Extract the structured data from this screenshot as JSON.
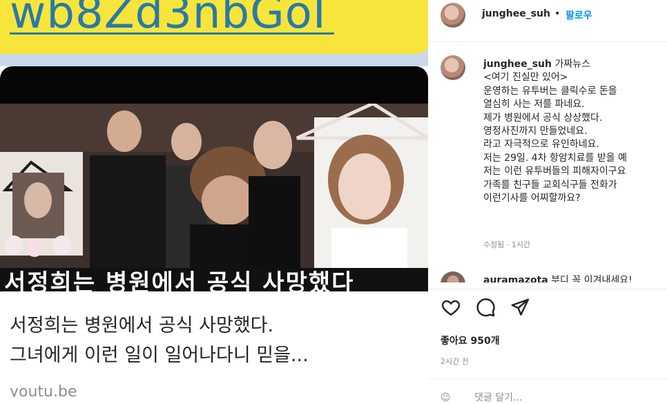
{
  "promo": {
    "url_text": "wb8Zd3nbGoI"
  },
  "video_card": {
    "caption_overlay": "서정희는 병원에서 공식 사망했다",
    "title_line1": "서정희는 병원에서 공식 사망했다.",
    "title_line2": "그녀에게 이런 일이 일어나다니 믿을...",
    "domain": "youtu.be"
  },
  "header": {
    "username": "junghee_suh",
    "separator": "•",
    "follow_label": "팔로우"
  },
  "post": {
    "username": "junghee_suh",
    "lines": [
      "가짜뉴스",
      "<여기 진실만 있어>",
      "운영하는 유투버는 클릭수로 돈을",
      "열심히 사는 저를 파네요.",
      "제가 병원에서 공식 상상했다.",
      "영정사진까지 만들었네요.",
      "라고 자극적으로 유인하네요.",
      "저는 29일. 4차 항암치료를 받을 예",
      "저는 이런 유투버들의 피해자이구요",
      "가족를 친구들 교회식구들 전화가",
      "이런기사를 어찌할까요?"
    ],
    "meta": "수정됨 · 1시간"
  },
  "comment": {
    "username": "auramazota",
    "text": "부디 꼭 이겨내세요!"
  },
  "actions": {
    "like_icon": "heart-icon",
    "comment_icon": "speech-bubble-icon",
    "share_icon": "paper-plane-icon"
  },
  "likes_text": "좋아요 950개",
  "time_text": "2시간 전",
  "add_comment_placeholder": "댓글 달기..."
}
